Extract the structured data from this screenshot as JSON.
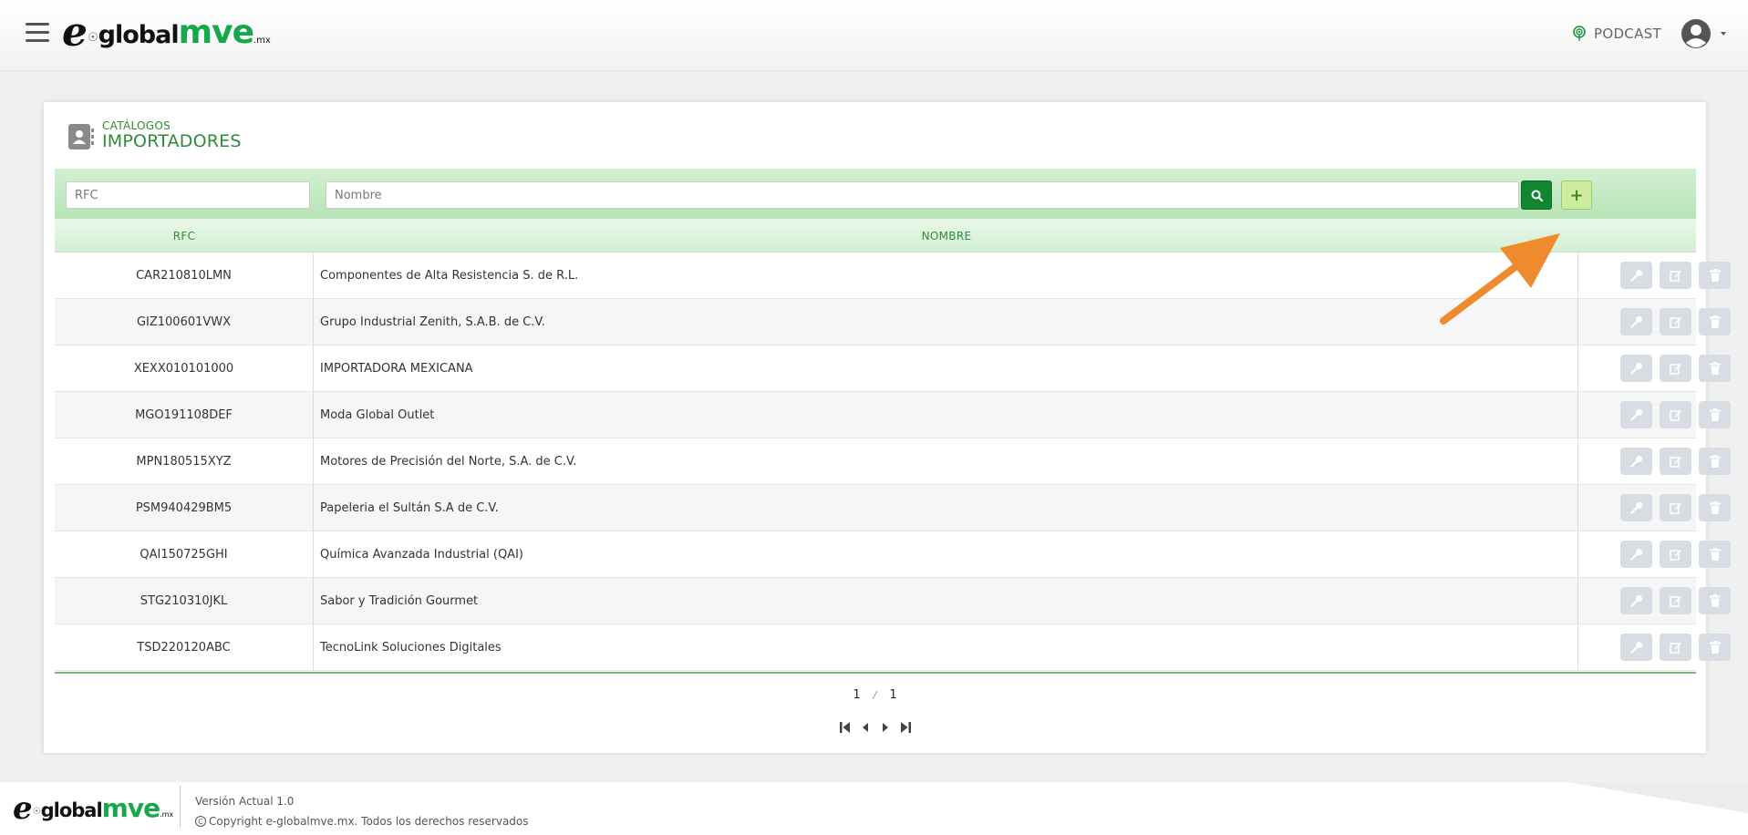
{
  "header": {
    "logo": {
      "e": "e",
      "global": "global",
      "mve": "mve",
      "mx": ".mx"
    },
    "podcast_label": "PODCAST"
  },
  "page": {
    "section_label": "CATÁLOGOS",
    "title": "IMPORTADORES"
  },
  "filters": {
    "rfc_placeholder": "RFC",
    "nombre_placeholder": "Nombre",
    "add_label": "+"
  },
  "table": {
    "columns": [
      "RFC",
      "NOMBRE"
    ],
    "rows": [
      {
        "rfc": "CAR210810LMN",
        "nombre": "Componentes de Alta Resistencia S. de R.L."
      },
      {
        "rfc": "GIZ100601VWX",
        "nombre": "Grupo Industrial Zenith, S.A.B. de C.V."
      },
      {
        "rfc": "XEXX010101000",
        "nombre": "IMPORTADORA MEXICANA"
      },
      {
        "rfc": "MGO191108DEF",
        "nombre": "Moda Global Outlet"
      },
      {
        "rfc": "MPN180515XYZ",
        "nombre": "Motores de Precisión del Norte, S.A. de C.V."
      },
      {
        "rfc": "PSM940429BM5",
        "nombre": "Papeleria el Sultán S.A de C.V."
      },
      {
        "rfc": "QAI150725GHI",
        "nombre": "Química Avanzada Industrial (QAI)"
      },
      {
        "rfc": "STG210310JKL",
        "nombre": "Sabor y Tradición Gourmet"
      },
      {
        "rfc": "TSD220120ABC",
        "nombre": "TecnoLink Soluciones Digitales"
      }
    ]
  },
  "pagination": {
    "current": "1",
    "separator": "/",
    "total": "1"
  },
  "footer": {
    "version": "Versión Actual 1.0",
    "copyright": "Copyright e-globalmve.mx. Todos los derechos reservados"
  },
  "colors": {
    "brand_green": "#17a84b",
    "dark_green": "#13842f",
    "annotation_arrow": "#ef8a2f"
  },
  "icons": {
    "menu": "hamburger-icon",
    "podcast": "podcast-icon",
    "user": "user-avatar-icon",
    "search": "search-icon",
    "row_actions": [
      "key-icon",
      "edit-icon",
      "trash-icon"
    ]
  }
}
